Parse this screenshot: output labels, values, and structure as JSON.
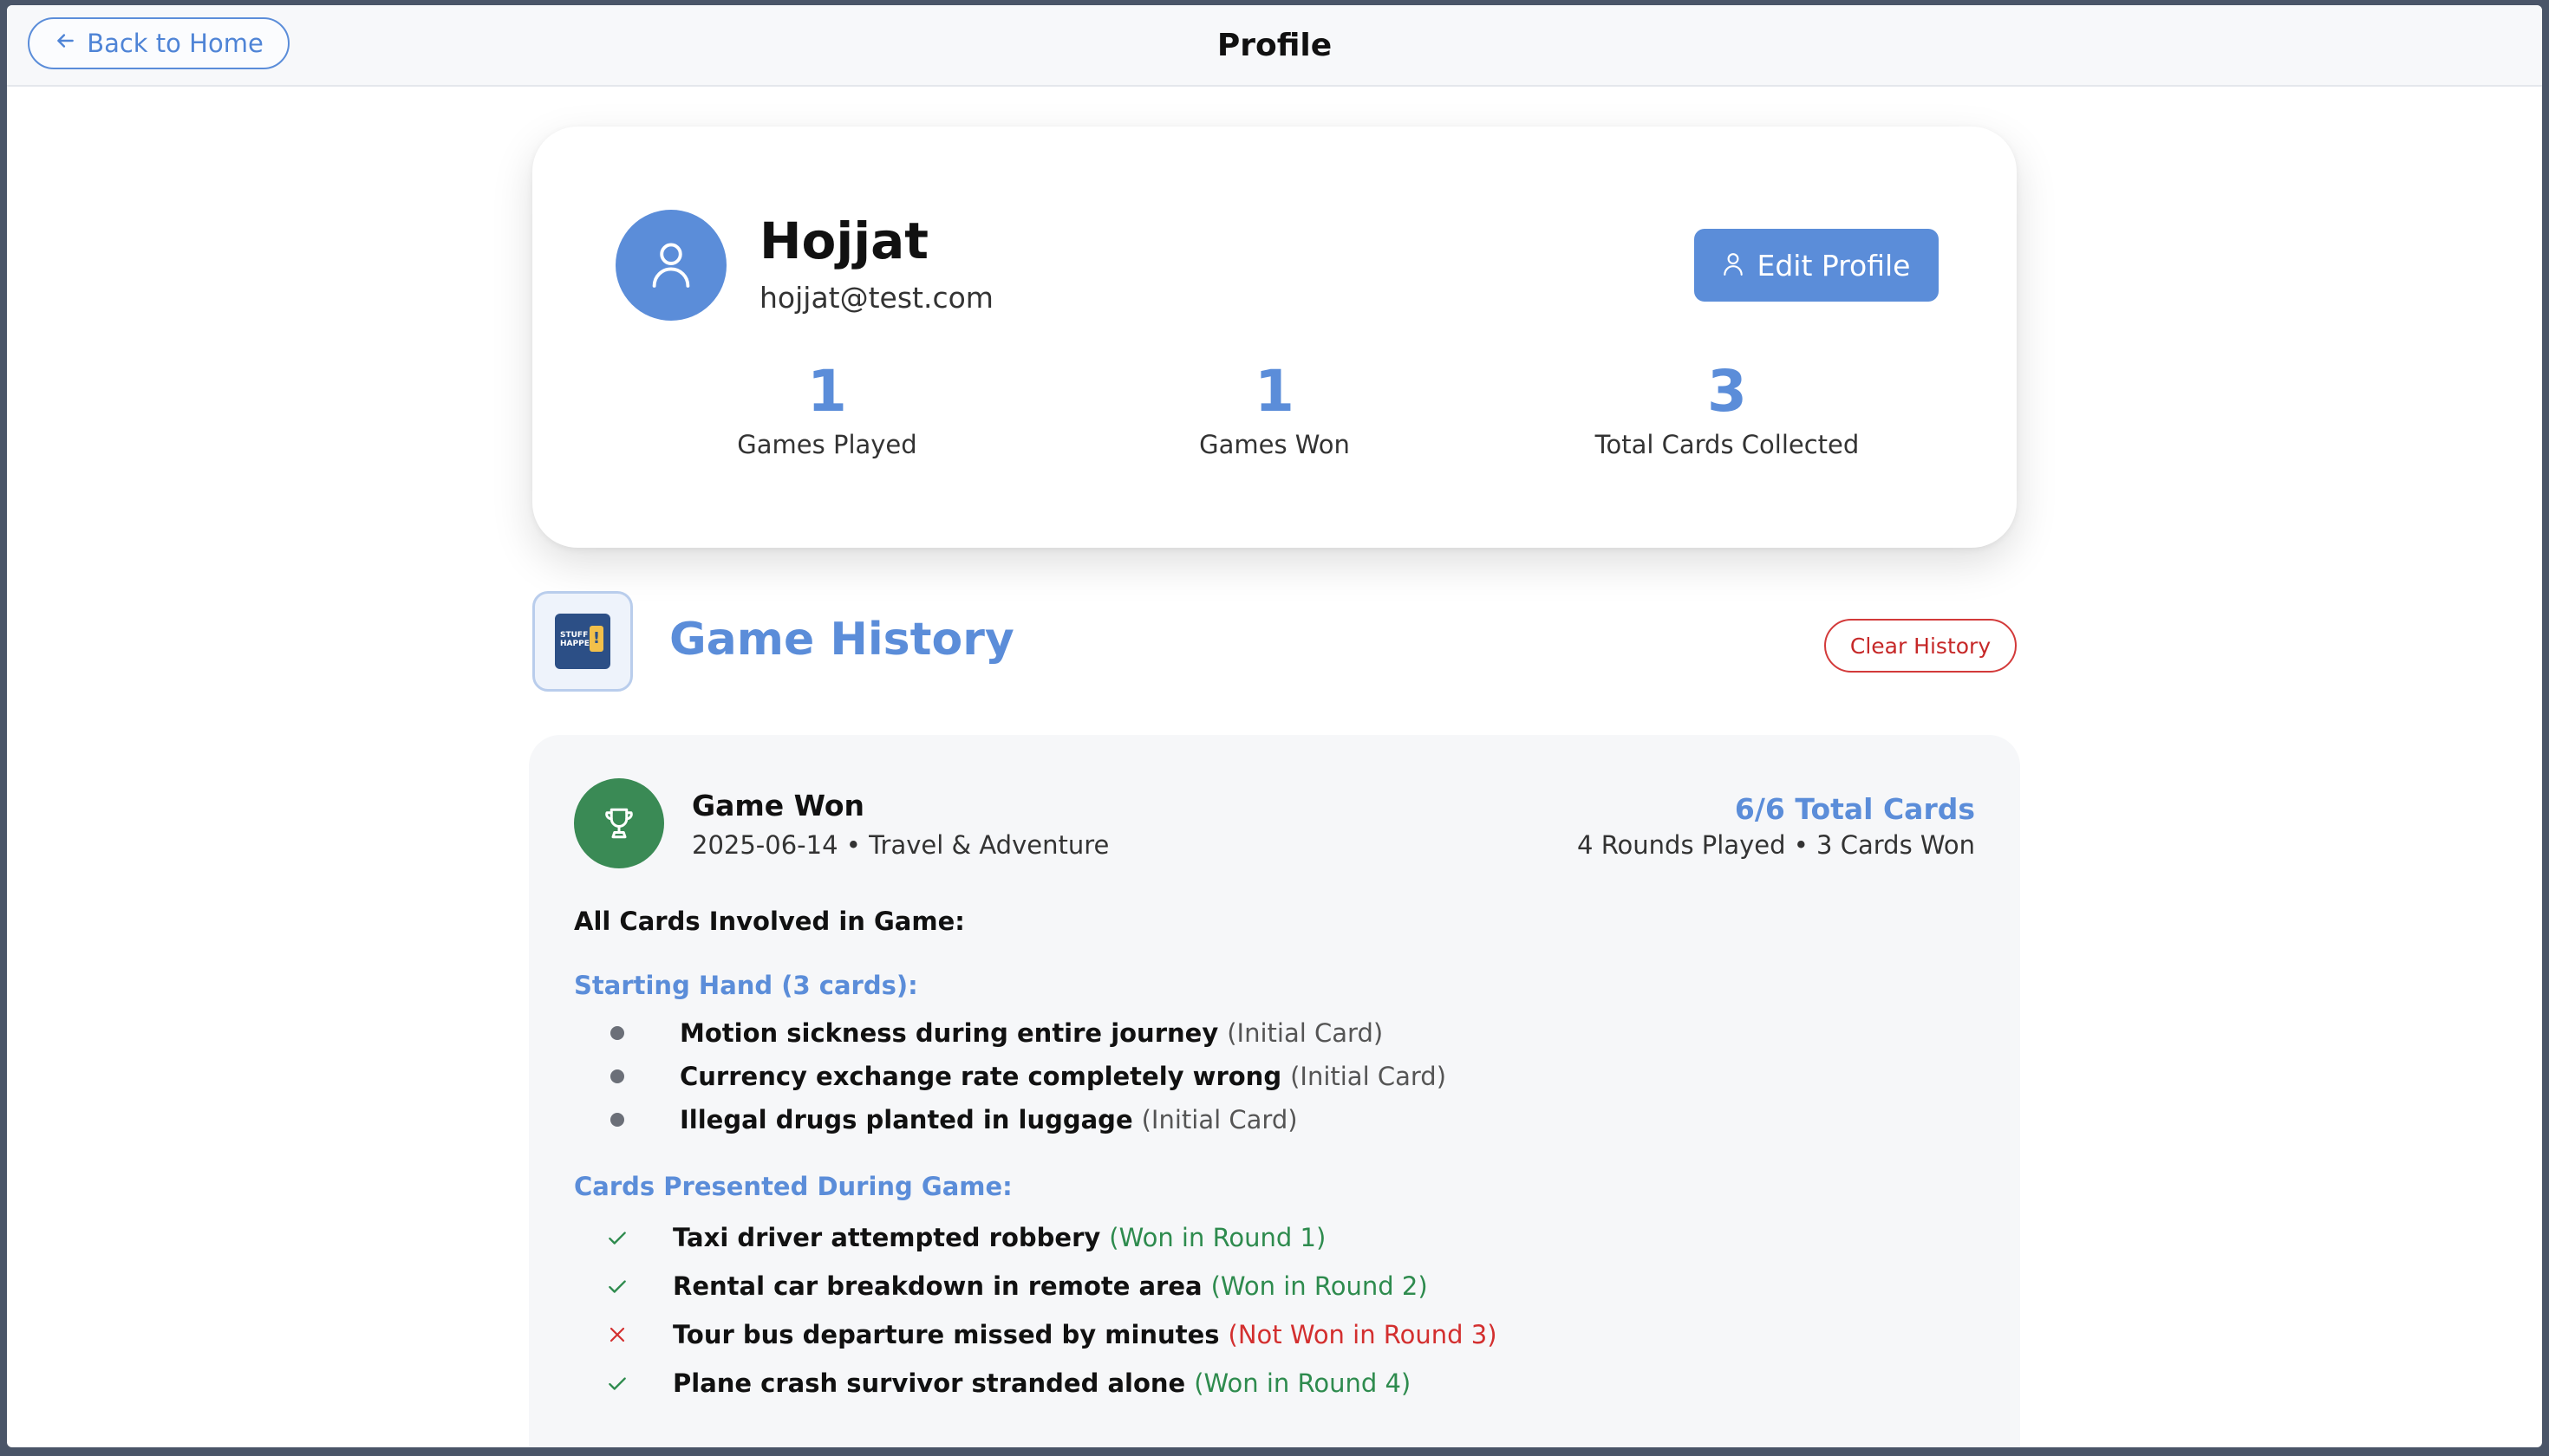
{
  "header": {
    "back_label": "Back to Home",
    "title": "Profile"
  },
  "profile": {
    "name": "Hojjat",
    "email": "hojjat@test.com",
    "edit_label": "Edit Profile",
    "stats": [
      {
        "value": "1",
        "label": "Games Played"
      },
      {
        "value": "1",
        "label": "Games Won"
      },
      {
        "value": "3",
        "label": "Total Cards Collected"
      }
    ]
  },
  "history": {
    "title": "Game History",
    "clear_label": "Clear History",
    "thumb_text": "STUFF HAPPENS",
    "games": [
      {
        "result": "Game Won",
        "meta": "2025-06-14 • Travel & Adventure",
        "total_cards": "6/6 Total Cards",
        "rounds_summary": "4 Rounds Played • 3 Cards Won",
        "involved_heading": "All Cards Involved in Game:",
        "starting_heading": "Starting Hand (3 cards):",
        "starting_cards": [
          {
            "title": "Motion sickness during entire journey",
            "note": "(Initial Card)"
          },
          {
            "title": "Currency exchange rate completely wrong",
            "note": "(Initial Card)"
          },
          {
            "title": "Illegal drugs planted in luggage",
            "note": "(Initial Card)"
          }
        ],
        "presented_heading": "Cards Presented During Game:",
        "presented_cards": [
          {
            "title": "Taxi driver attempted robbery",
            "note": "(Won in Round 1)",
            "won": true
          },
          {
            "title": "Rental car breakdown in remote area",
            "note": "(Won in Round 2)",
            "won": true
          },
          {
            "title": "Tour bus departure missed by minutes",
            "note": "(Not Won in Round 3)",
            "won": false
          },
          {
            "title": "Plane crash survivor stranded alone",
            "note": "(Won in Round 4)",
            "won": true
          }
        ]
      }
    ]
  },
  "colors": {
    "accent": "#5b8dd9",
    "success": "#3a8a55",
    "danger": "#d32f2f"
  }
}
